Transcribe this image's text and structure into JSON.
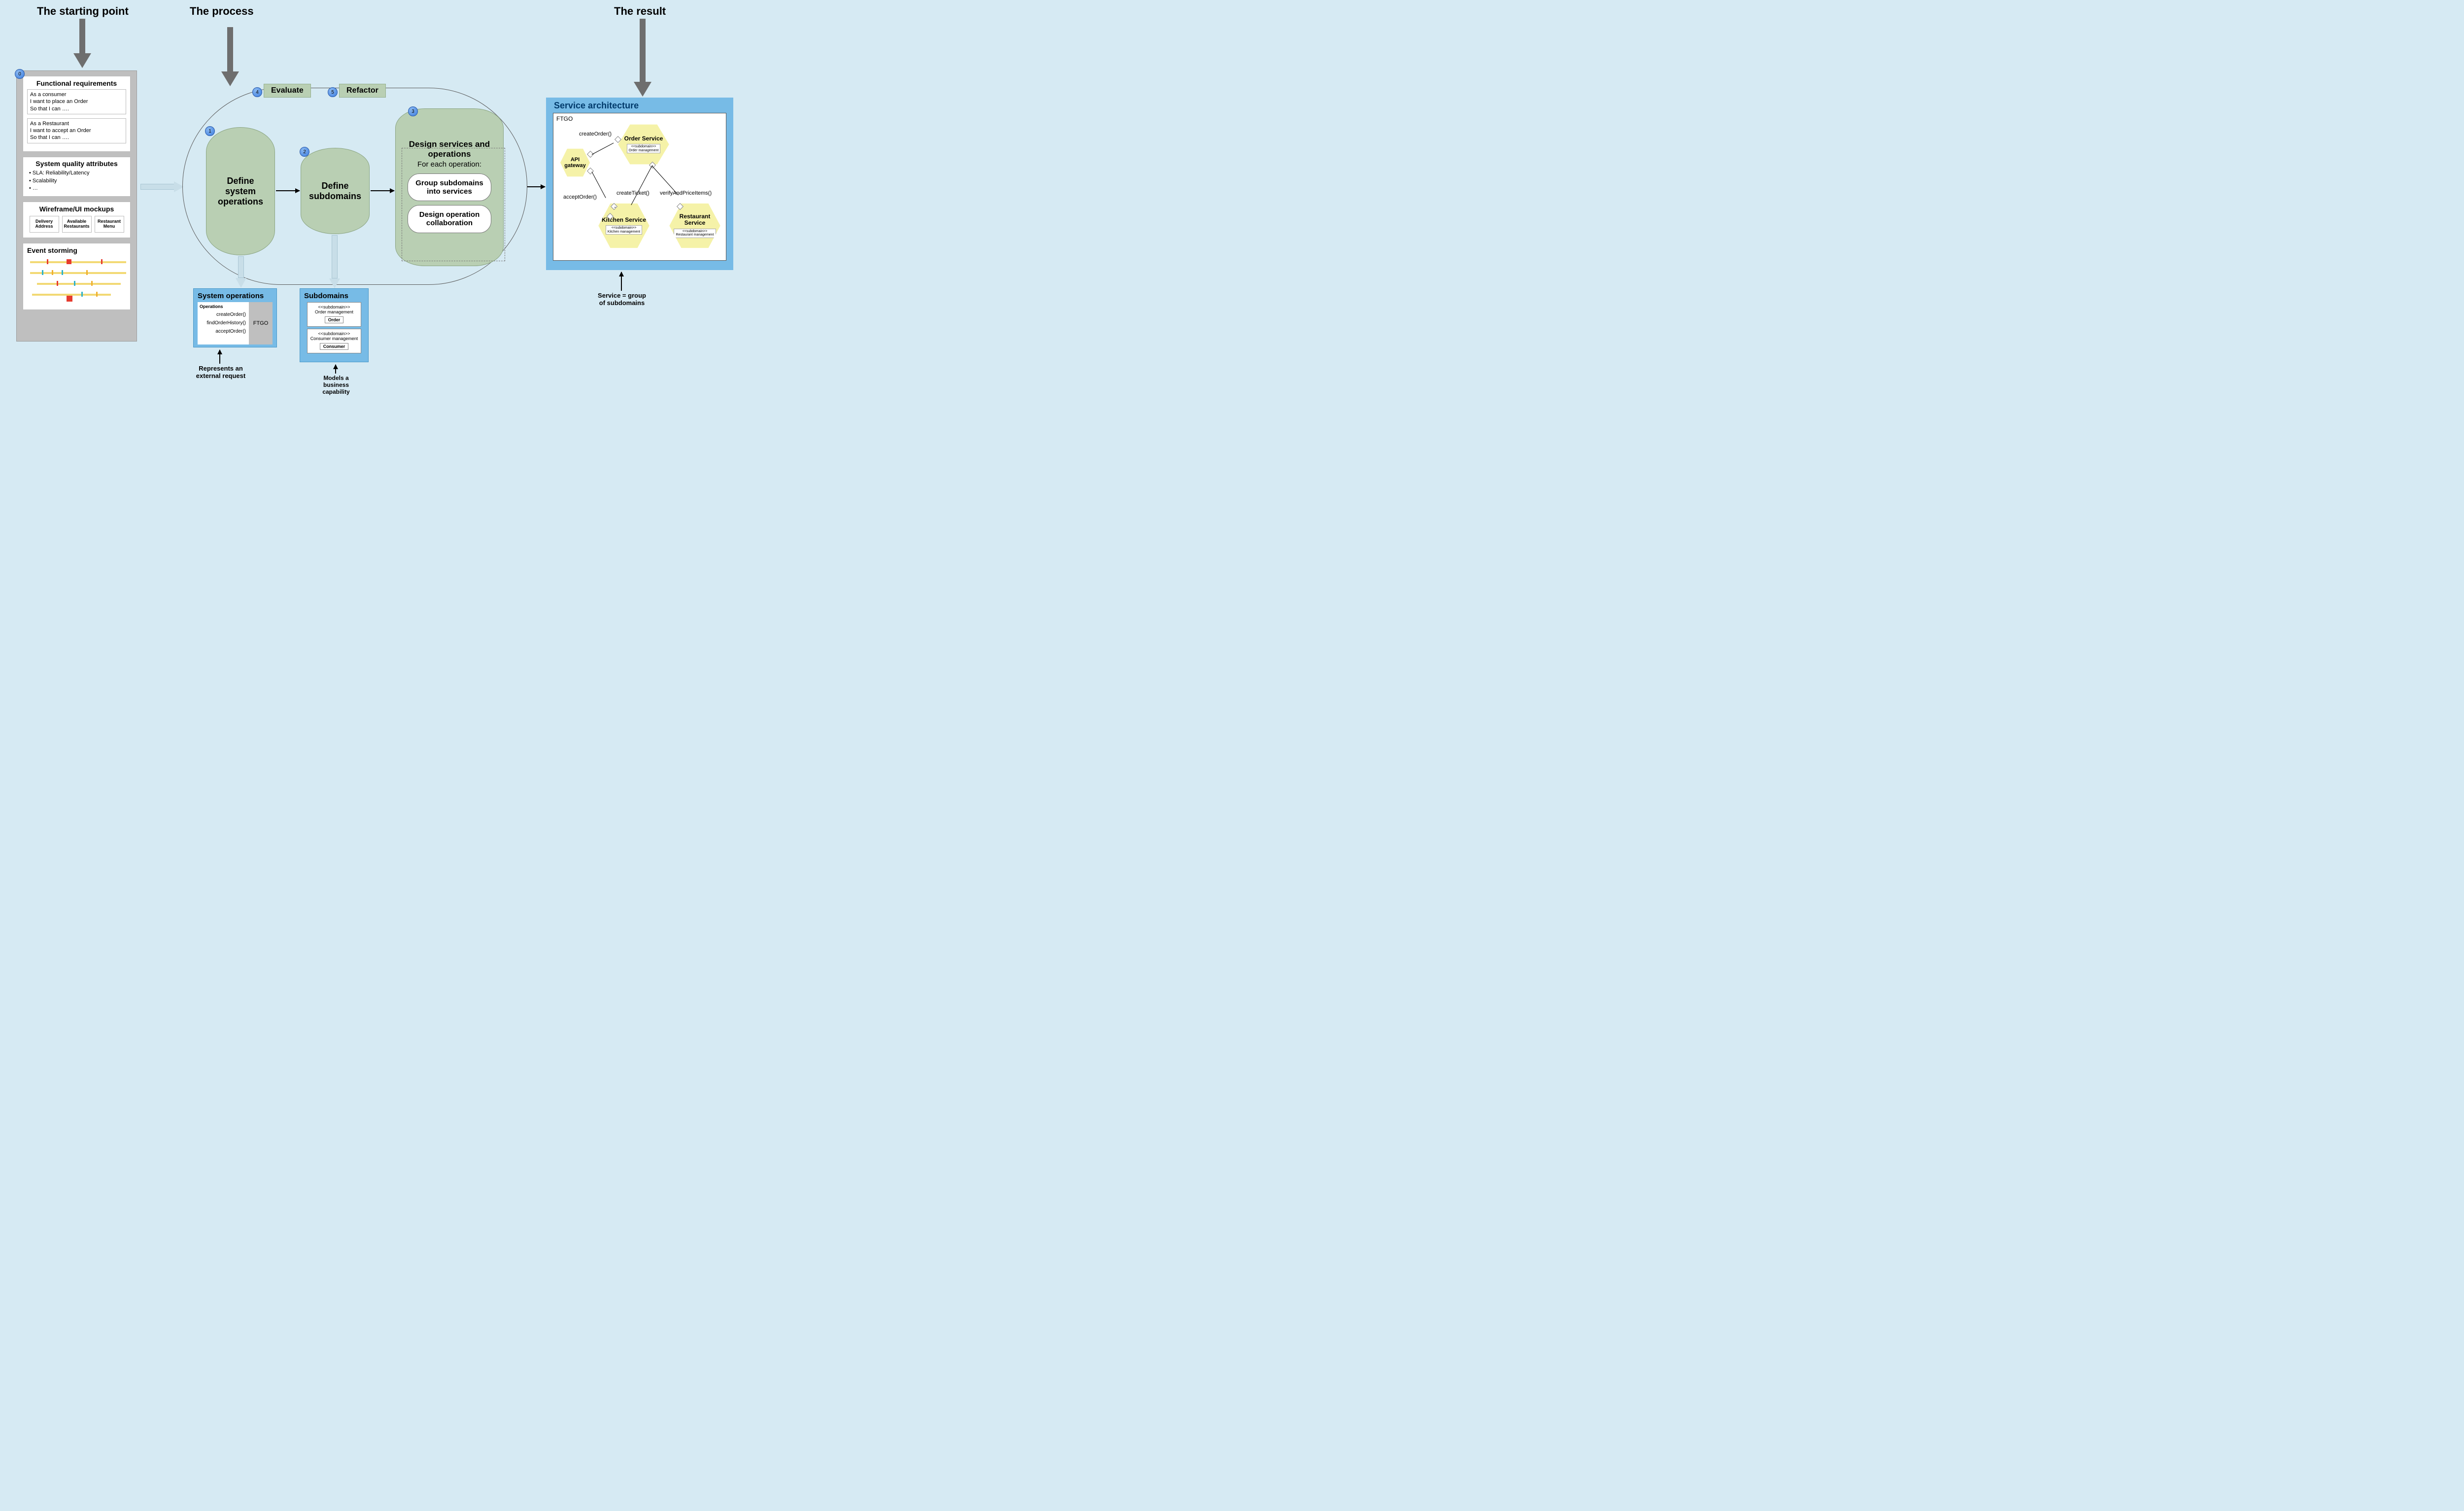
{
  "sections": {
    "starting": "The starting point",
    "process": "The process",
    "result": "The result"
  },
  "badges": {
    "b0": "0",
    "b1": "1",
    "b2": "2",
    "b3": "3",
    "b4": "4",
    "b5": "5"
  },
  "starting": {
    "func_title": "Functional requirements",
    "story1_l1": "As a consumer",
    "story1_l2": "I want to place an Order",
    "story1_l3": "So that I can ….",
    "story2_l1": "As a Restaurant",
    "story2_l2": "I want to accept an Order",
    "story2_l3": "So that I can ….",
    "sqa_title": "System quality attributes",
    "sqa_items": [
      "• SLA: Reliability/Latency",
      "• Scalability",
      "• …"
    ],
    "wire_title": "Wireframe/UI mockups",
    "wire_boxes": [
      "Delivery Address",
      "Available Restaurants",
      "Restaurant Menu"
    ],
    "es_title": "Event storming"
  },
  "process": {
    "evaluate": "Evaluate",
    "refactor": "Refactor",
    "pill1": "Define\nsystem\noperations",
    "pill2": "Define\nsubdomains",
    "pill3_title": "Design services and operations",
    "pill3_sub": "For each operation:",
    "pill3_b1": "Group subdomains into services",
    "pill3_b2": "Design operation collaboration"
  },
  "sysops": {
    "title": "System operations",
    "ops_head": "Operations",
    "ops": [
      "createOrder()",
      "findOrderHistory()",
      "acceptOrder()"
    ],
    "ftgo": "FTGO",
    "caption": "Represents an\nexternal request"
  },
  "subdomains": {
    "title": "Subdomains",
    "card1_stereo": "<<subdomain>>",
    "card1_name": "Order management",
    "card1_entity": "Order",
    "card2_stereo": "<<subdomain>>",
    "card2_name": "Consumer management",
    "card2_entity": "Consumer",
    "caption": "Models a\nbusiness\ncapability"
  },
  "result": {
    "title": "Service architecture",
    "ftgo": "FTGO",
    "api_gateway": "API gateway",
    "order_service": "Order Service",
    "kitchen_service": "Kitchen Service",
    "restaurant_service": "Restaurant Service",
    "sd_order": "<<subdomain>>\nOrder management",
    "sd_kitchen": "<<subdomain>>\nKitchen management",
    "sd_restaurant": "<<subdomain>>\nRestaurant management",
    "call_createOrder": "createOrder()",
    "call_acceptOrder": "acceptOrder()",
    "call_createTicket": "createTicket()",
    "call_verify": "verifyAndPriceItems()",
    "caption": "Service = group\nof subdomains"
  }
}
